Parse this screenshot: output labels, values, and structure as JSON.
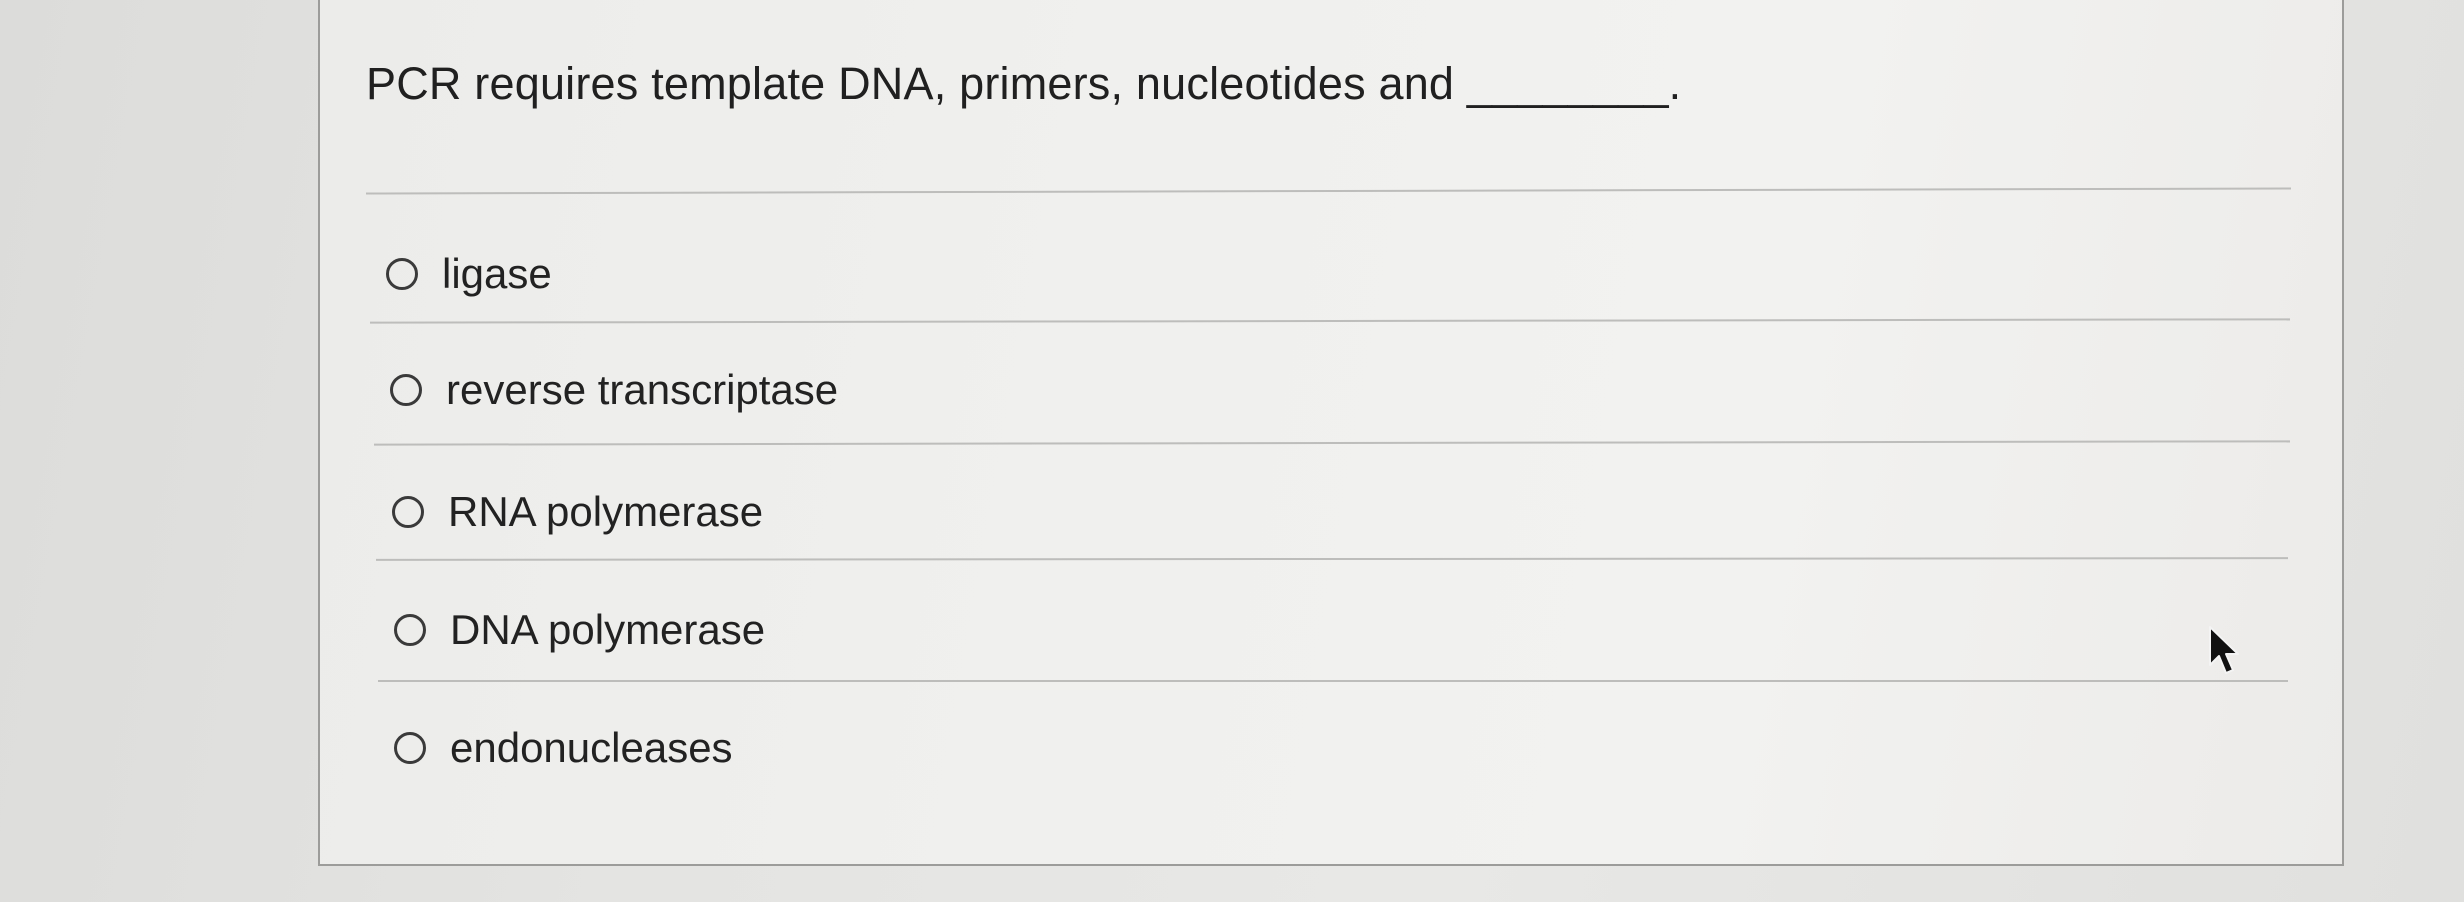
{
  "question": {
    "text": "PCR requires template DNA, primers, nucleotides and ________."
  },
  "options": [
    {
      "label": "ligase",
      "selected": false
    },
    {
      "label": "reverse transcriptase",
      "selected": false
    },
    {
      "label": "RNA polymerase",
      "selected": false
    },
    {
      "label": "DNA polymerase",
      "selected": false
    },
    {
      "label": "endonucleases",
      "selected": false
    }
  ],
  "icons": {
    "radio": "radio-unselected-icon",
    "cursor": "mouse-pointer-icon"
  }
}
